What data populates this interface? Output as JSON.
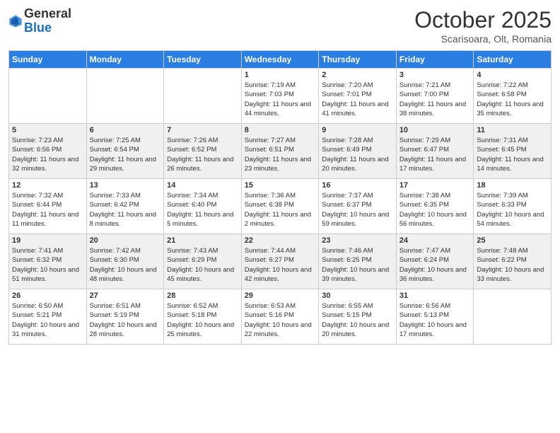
{
  "logo": {
    "general": "General",
    "blue": "Blue"
  },
  "title": "October 2025",
  "subtitle": "Scarisoara, Olt, Romania",
  "days_of_week": [
    "Sunday",
    "Monday",
    "Tuesday",
    "Wednesday",
    "Thursday",
    "Friday",
    "Saturday"
  ],
  "weeks": [
    [
      {
        "day": "",
        "info": ""
      },
      {
        "day": "",
        "info": ""
      },
      {
        "day": "",
        "info": ""
      },
      {
        "day": "1",
        "info": "Sunrise: 7:19 AM\nSunset: 7:03 PM\nDaylight: 11 hours and 44 minutes."
      },
      {
        "day": "2",
        "info": "Sunrise: 7:20 AM\nSunset: 7:01 PM\nDaylight: 11 hours and 41 minutes."
      },
      {
        "day": "3",
        "info": "Sunrise: 7:21 AM\nSunset: 7:00 PM\nDaylight: 11 hours and 38 minutes."
      },
      {
        "day": "4",
        "info": "Sunrise: 7:22 AM\nSunset: 6:58 PM\nDaylight: 11 hours and 35 minutes."
      }
    ],
    [
      {
        "day": "5",
        "info": "Sunrise: 7:23 AM\nSunset: 6:56 PM\nDaylight: 11 hours and 32 minutes."
      },
      {
        "day": "6",
        "info": "Sunrise: 7:25 AM\nSunset: 6:54 PM\nDaylight: 11 hours and 29 minutes."
      },
      {
        "day": "7",
        "info": "Sunrise: 7:26 AM\nSunset: 6:52 PM\nDaylight: 11 hours and 26 minutes."
      },
      {
        "day": "8",
        "info": "Sunrise: 7:27 AM\nSunset: 6:51 PM\nDaylight: 11 hours and 23 minutes."
      },
      {
        "day": "9",
        "info": "Sunrise: 7:28 AM\nSunset: 6:49 PM\nDaylight: 11 hours and 20 minutes."
      },
      {
        "day": "10",
        "info": "Sunrise: 7:29 AM\nSunset: 6:47 PM\nDaylight: 11 hours and 17 minutes."
      },
      {
        "day": "11",
        "info": "Sunrise: 7:31 AM\nSunset: 6:45 PM\nDaylight: 11 hours and 14 minutes."
      }
    ],
    [
      {
        "day": "12",
        "info": "Sunrise: 7:32 AM\nSunset: 6:44 PM\nDaylight: 11 hours and 11 minutes."
      },
      {
        "day": "13",
        "info": "Sunrise: 7:33 AM\nSunset: 6:42 PM\nDaylight: 11 hours and 8 minutes."
      },
      {
        "day": "14",
        "info": "Sunrise: 7:34 AM\nSunset: 6:40 PM\nDaylight: 11 hours and 5 minutes."
      },
      {
        "day": "15",
        "info": "Sunrise: 7:36 AM\nSunset: 6:38 PM\nDaylight: 11 hours and 2 minutes."
      },
      {
        "day": "16",
        "info": "Sunrise: 7:37 AM\nSunset: 6:37 PM\nDaylight: 10 hours and 59 minutes."
      },
      {
        "day": "17",
        "info": "Sunrise: 7:38 AM\nSunset: 6:35 PM\nDaylight: 10 hours and 56 minutes."
      },
      {
        "day": "18",
        "info": "Sunrise: 7:39 AM\nSunset: 6:33 PM\nDaylight: 10 hours and 54 minutes."
      }
    ],
    [
      {
        "day": "19",
        "info": "Sunrise: 7:41 AM\nSunset: 6:32 PM\nDaylight: 10 hours and 51 minutes."
      },
      {
        "day": "20",
        "info": "Sunrise: 7:42 AM\nSunset: 6:30 PM\nDaylight: 10 hours and 48 minutes."
      },
      {
        "day": "21",
        "info": "Sunrise: 7:43 AM\nSunset: 6:29 PM\nDaylight: 10 hours and 45 minutes."
      },
      {
        "day": "22",
        "info": "Sunrise: 7:44 AM\nSunset: 6:27 PM\nDaylight: 10 hours and 42 minutes."
      },
      {
        "day": "23",
        "info": "Sunrise: 7:46 AM\nSunset: 6:25 PM\nDaylight: 10 hours and 39 minutes."
      },
      {
        "day": "24",
        "info": "Sunrise: 7:47 AM\nSunset: 6:24 PM\nDaylight: 10 hours and 36 minutes."
      },
      {
        "day": "25",
        "info": "Sunrise: 7:48 AM\nSunset: 6:22 PM\nDaylight: 10 hours and 33 minutes."
      }
    ],
    [
      {
        "day": "26",
        "info": "Sunrise: 6:50 AM\nSunset: 5:21 PM\nDaylight: 10 hours and 31 minutes."
      },
      {
        "day": "27",
        "info": "Sunrise: 6:51 AM\nSunset: 5:19 PM\nDaylight: 10 hours and 28 minutes."
      },
      {
        "day": "28",
        "info": "Sunrise: 6:52 AM\nSunset: 5:18 PM\nDaylight: 10 hours and 25 minutes."
      },
      {
        "day": "29",
        "info": "Sunrise: 6:53 AM\nSunset: 5:16 PM\nDaylight: 10 hours and 22 minutes."
      },
      {
        "day": "30",
        "info": "Sunrise: 6:55 AM\nSunset: 5:15 PM\nDaylight: 10 hours and 20 minutes."
      },
      {
        "day": "31",
        "info": "Sunrise: 6:56 AM\nSunset: 5:13 PM\nDaylight: 10 hours and 17 minutes."
      },
      {
        "day": "",
        "info": ""
      }
    ]
  ]
}
